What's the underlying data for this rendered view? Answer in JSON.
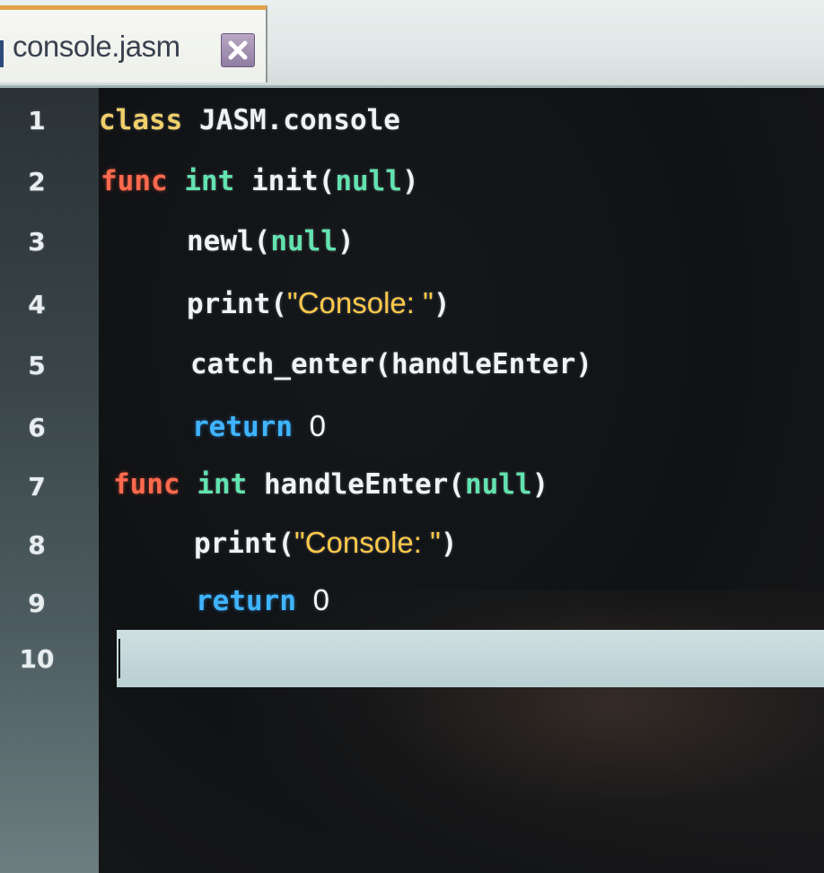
{
  "tab": {
    "filename": "console.jasm",
    "close_icon": "close-icon"
  },
  "editor": {
    "line_numbers": [
      "1",
      "2",
      "3",
      "4",
      "5",
      "6",
      "7",
      "8",
      "9",
      "10"
    ],
    "current_line": "10",
    "lines": [
      {
        "tokens": [
          {
            "t": "class",
            "k": "kw-class"
          },
          {
            "t": " JASM.console"
          }
        ]
      },
      {
        "tokens": [
          {
            "t": "func",
            "k": "kw-func"
          },
          {
            "t": " "
          },
          {
            "t": "int",
            "k": "kw-type"
          },
          {
            "t": " init("
          },
          {
            "t": "null",
            "k": "kw-null"
          },
          {
            "t": ")"
          }
        ]
      },
      {
        "tokens": [
          {
            "t": "newl("
          },
          {
            "t": "null",
            "k": "kw-null"
          },
          {
            "t": ")"
          }
        ]
      },
      {
        "tokens": [
          {
            "t": "print("
          },
          {
            "t": "\"Console: \"",
            "k": "str"
          },
          {
            "t": ")"
          }
        ]
      },
      {
        "tokens": [
          {
            "t": "catch_enter(handleEnter)"
          }
        ]
      },
      {
        "tokens": [
          {
            "t": "return",
            "k": "kw-return"
          },
          {
            "t": " "
          },
          {
            "t": "0",
            "k": "num"
          }
        ]
      },
      {
        "tokens": [
          {
            "t": "func",
            "k": "kw-func"
          },
          {
            "t": " "
          },
          {
            "t": "int",
            "k": "kw-type"
          },
          {
            "t": " handleEnter("
          },
          {
            "t": "null",
            "k": "kw-null"
          },
          {
            "t": ")"
          }
        ]
      },
      {
        "tokens": [
          {
            "t": "print("
          },
          {
            "t": "\"Console: \"",
            "k": "str"
          },
          {
            "t": ")"
          }
        ]
      },
      {
        "tokens": [
          {
            "t": "return",
            "k": "kw-return"
          },
          {
            "t": " "
          },
          {
            "t": "0",
            "k": "num"
          }
        ]
      },
      {
        "tokens": []
      }
    ]
  },
  "colors": {
    "keyword_class": "#f0cf6a",
    "keyword_func": "#ff6a4e",
    "keyword_type": "#62e3b0",
    "keyword_return": "#3fb4ff",
    "string": "#ffc94a",
    "tab_accent": "#e3a24a"
  }
}
